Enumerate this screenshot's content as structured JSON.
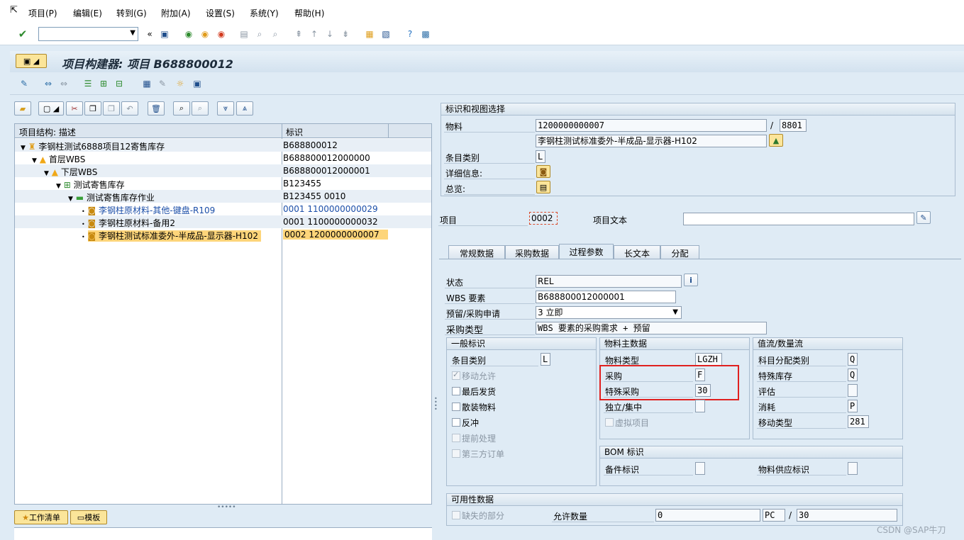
{
  "menu": {
    "items": [
      {
        "label": "项目(P)"
      },
      {
        "label": "编辑(E)"
      },
      {
        "label": "转到(G)"
      },
      {
        "label": "附加(A)"
      },
      {
        "label": "设置(S)"
      },
      {
        "label": "系统(Y)"
      },
      {
        "label": "帮助(H)"
      }
    ]
  },
  "command_field": {
    "value": ""
  },
  "title": {
    "text": "项目构建器: 项目 B688800012"
  },
  "tree": {
    "col_desc": "项目结构: 描述",
    "col_id": "标识",
    "rows": [
      {
        "desc": "李钢柱测试6888项目12寄售库存",
        "id": "B688800012"
      },
      {
        "desc": "首层WBS",
        "id": "B688800012000000"
      },
      {
        "desc": "下层WBS",
        "id": "B688800012000001"
      },
      {
        "desc": "测试寄售库存",
        "id": "B123455"
      },
      {
        "desc": "测试寄售库存作业",
        "id": "B123455 0010"
      },
      {
        "desc": "李钢柱原材料-其他-键盘-R109",
        "id": "0001 1100000000029"
      },
      {
        "desc": "李钢柱原材料-备用2",
        "id": "0001 1100000000032"
      },
      {
        "desc": "李钢柱测试标准委外-半成品-显示器-H102",
        "id": "0002 1200000000007"
      }
    ]
  },
  "bottom_buttons": {
    "worklist": "工作清单",
    "template": "模板"
  },
  "ident": {
    "section_title": "标识和视图选择",
    "material_label": "物料",
    "material_value": "1200000000007",
    "slash": "/",
    "plant_value": "8801",
    "material_desc": "李钢柱测试标准委外-半成品-显示器-H102",
    "item_cat_label": "条目类别",
    "item_cat_value": "L",
    "detail_label": "详细信息:",
    "overview_label": "总览:"
  },
  "item": {
    "label": "项目",
    "value": "0002",
    "text_label": "项目文本",
    "text_value": ""
  },
  "tabs": [
    {
      "label": "常规数据"
    },
    {
      "label": "采购数据"
    },
    {
      "label": "过程参数"
    },
    {
      "label": "长文本"
    },
    {
      "label": "分配"
    }
  ],
  "process": {
    "status_label": "状态",
    "status_value": "REL",
    "wbs_label": "WBS 要素",
    "wbs_value": "B688800012000001",
    "reservation_label": "预留/采购申请",
    "reservation_value": "3 立即",
    "purchase_type_label": "采购类型",
    "purchase_type_value": "WBS 要素的采购需求 + 预留"
  },
  "general": {
    "title": "一般标识",
    "item_cat_label": "条目类别",
    "item_cat_value": "L",
    "movement_allowed": "移动允许",
    "last_issue": "最后发货",
    "bulk_material": "散装物料",
    "backflush": "反冲",
    "advance_processing": "提前处理",
    "third_party": "第三方订单"
  },
  "material_master": {
    "title": "物料主数据",
    "type_label": "物料类型",
    "type_value": "LGZH",
    "procurement_label": "采购",
    "procurement_value": "F",
    "special_proc_label": "特殊采购",
    "special_proc_value": "30",
    "indep_label": "独立/集中",
    "phantom_label": "虚拟项目"
  },
  "value_flow": {
    "title": "值流/数量流",
    "acct_assign_label": "科目分配类别",
    "acct_assign_value": "Q",
    "special_stock_label": "特殊库存",
    "special_stock_value": "Q",
    "valuation_label": "评估",
    "consumption_label": "消耗",
    "consumption_value": "P",
    "movement_type_label": "移动类型",
    "movement_type_value": "281"
  },
  "bom": {
    "title": "BOM 标识",
    "spare_part_label": "备件标识",
    "material_supply_label": "物料供应标识"
  },
  "availability": {
    "title": "可用性数据",
    "missing_parts_label": "缺失的部分",
    "permitted_qty_label": "允许数量",
    "qty_value": "0",
    "unit_value": "PC",
    "slash": "/",
    "qty2_value": "30"
  },
  "watermark": "CSDN @SAP牛刀",
  "colors": {
    "highlight_box": "#e0201f",
    "selection": "#fdd57a"
  }
}
